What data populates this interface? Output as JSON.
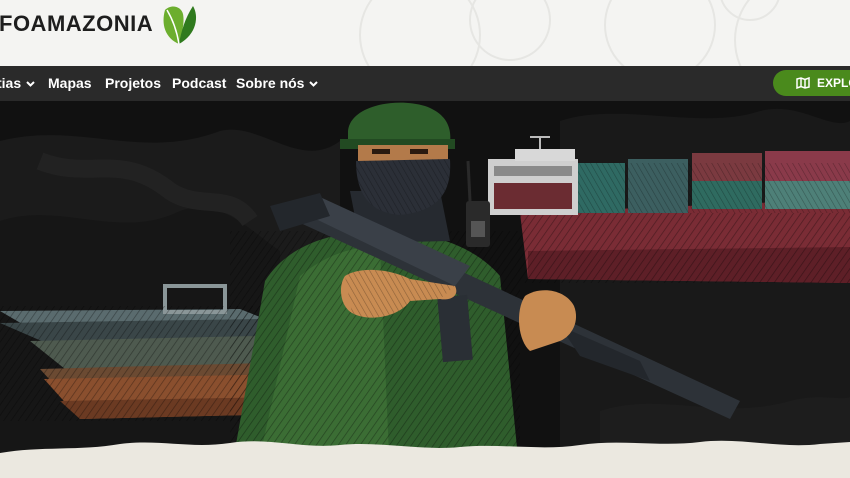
{
  "header": {
    "logo_text": "FOAMAZONIA",
    "logo_icon": "leaf-icon"
  },
  "nav": {
    "items": [
      {
        "label": "tias",
        "has_dropdown": true
      },
      {
        "label": "Mapas",
        "has_dropdown": false
      },
      {
        "label": "Projetos",
        "has_dropdown": false
      },
      {
        "label": "Podcast",
        "has_dropdown": false
      },
      {
        "label": "Sobre nós",
        "has_dropdown": true
      }
    ],
    "explore_label": "EXPLO",
    "explore_icon": "map-icon"
  },
  "colors": {
    "nav_bg": "#2a2a2a",
    "accent_green": "#4a8a1c",
    "header_bg": "#f4f4f2",
    "hero_bg": "#0f0f0f"
  },
  "hero": {
    "illustration": "armed-soldier-with-boats-and-cargo-ship"
  }
}
